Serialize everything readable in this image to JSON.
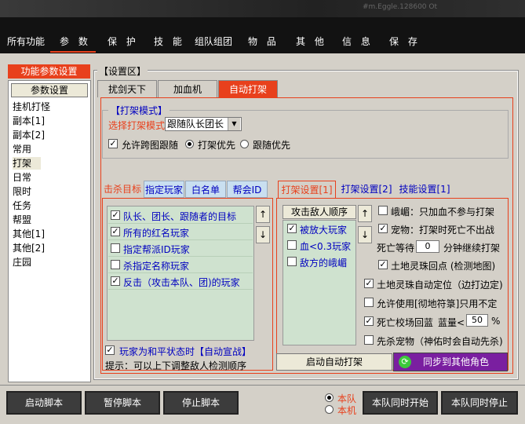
{
  "top_bar_blurred": "#m.Eggle.128600 Ot",
  "menu": [
    "所有功能",
    "参 数",
    "保 护",
    "技 能",
    "组队组团",
    "物 品",
    "其 他",
    "信 息",
    "保 存"
  ],
  "left": {
    "header": "功能参数设置",
    "selected": "参数设置",
    "items": [
      "挂机打怪",
      "副本[1]",
      "副本[2]",
      "常用",
      "打架",
      "日常",
      "限时",
      "任务",
      "帮盟",
      "其他[1]",
      "其他[2]",
      "庄园"
    ]
  },
  "settings": {
    "legend": "【设置区】",
    "tabs": [
      "扰剑天下",
      "加血机",
      "自动打架"
    ],
    "mode_legend": "【打架模式】",
    "mode_label": "选择打架模式",
    "mode_value": "跟随队长团长",
    "cross_map": "允许跨图跟随",
    "radio_fight": "打架优先",
    "radio_follow": "跟随优先"
  },
  "targets": {
    "tabs": [
      "击杀目标",
      "指定玩家",
      "白名单",
      "帮会ID"
    ],
    "rows": [
      {
        "label": "队长、团长、跟随者的目标",
        "checked": true
      },
      {
        "label": "所有的红名玩家",
        "checked": true
      },
      {
        "label": "指定帮派ID玩家",
        "checked": false
      },
      {
        "label": "杀指定名称玩家",
        "checked": false
      },
      {
        "label": "反击（攻击本队、团)的玩家",
        "checked": true
      }
    ],
    "declare": "玩家为和平状态时【自动宣战】",
    "hint": "提示：可以上下调整敌人检测顺序"
  },
  "attack": {
    "tabs": [
      "打架设置[1]",
      "打架设置[2]",
      "技能设置[1]"
    ],
    "order_head": "攻击敌人顺序",
    "order_rows": [
      {
        "label": "被放大玩家",
        "checked": true
      },
      {
        "label": "血<0.3玩家",
        "checked": false
      },
      {
        "label": "敌方的峨嵋",
        "checked": false
      }
    ],
    "opt_emei": "峨嵋：只加血不参与打架",
    "opt_pet": "宠物：打架时死亡不出战",
    "wait_prefix": "死亡等待",
    "wait_value": "0",
    "wait_suffix": "分钟继续打架",
    "opt_land_return": "土地灵珠回点 (检测地图)",
    "opt_land_locate": "土地灵珠自动定位（边打边定)",
    "opt_back_village": "允许使用[彻地符箓]只用不定",
    "opt_death_field": "死亡校场回蓝",
    "blue_label": "蓝量<",
    "blue_value": "50",
    "blue_unit": "%",
    "opt_kill_pet": "先杀宠物（神佑时会自动先杀)",
    "start_button": "启动自动打架",
    "sync_button": "同步到其他角色"
  },
  "bottom": {
    "start_script": "启动脚本",
    "pause_script": "暂停脚本",
    "stop_script": "停止脚本",
    "radio_team": "本队",
    "radio_local": "本机",
    "team_start": "本队同时开始",
    "team_stop": "本队同时停止"
  }
}
